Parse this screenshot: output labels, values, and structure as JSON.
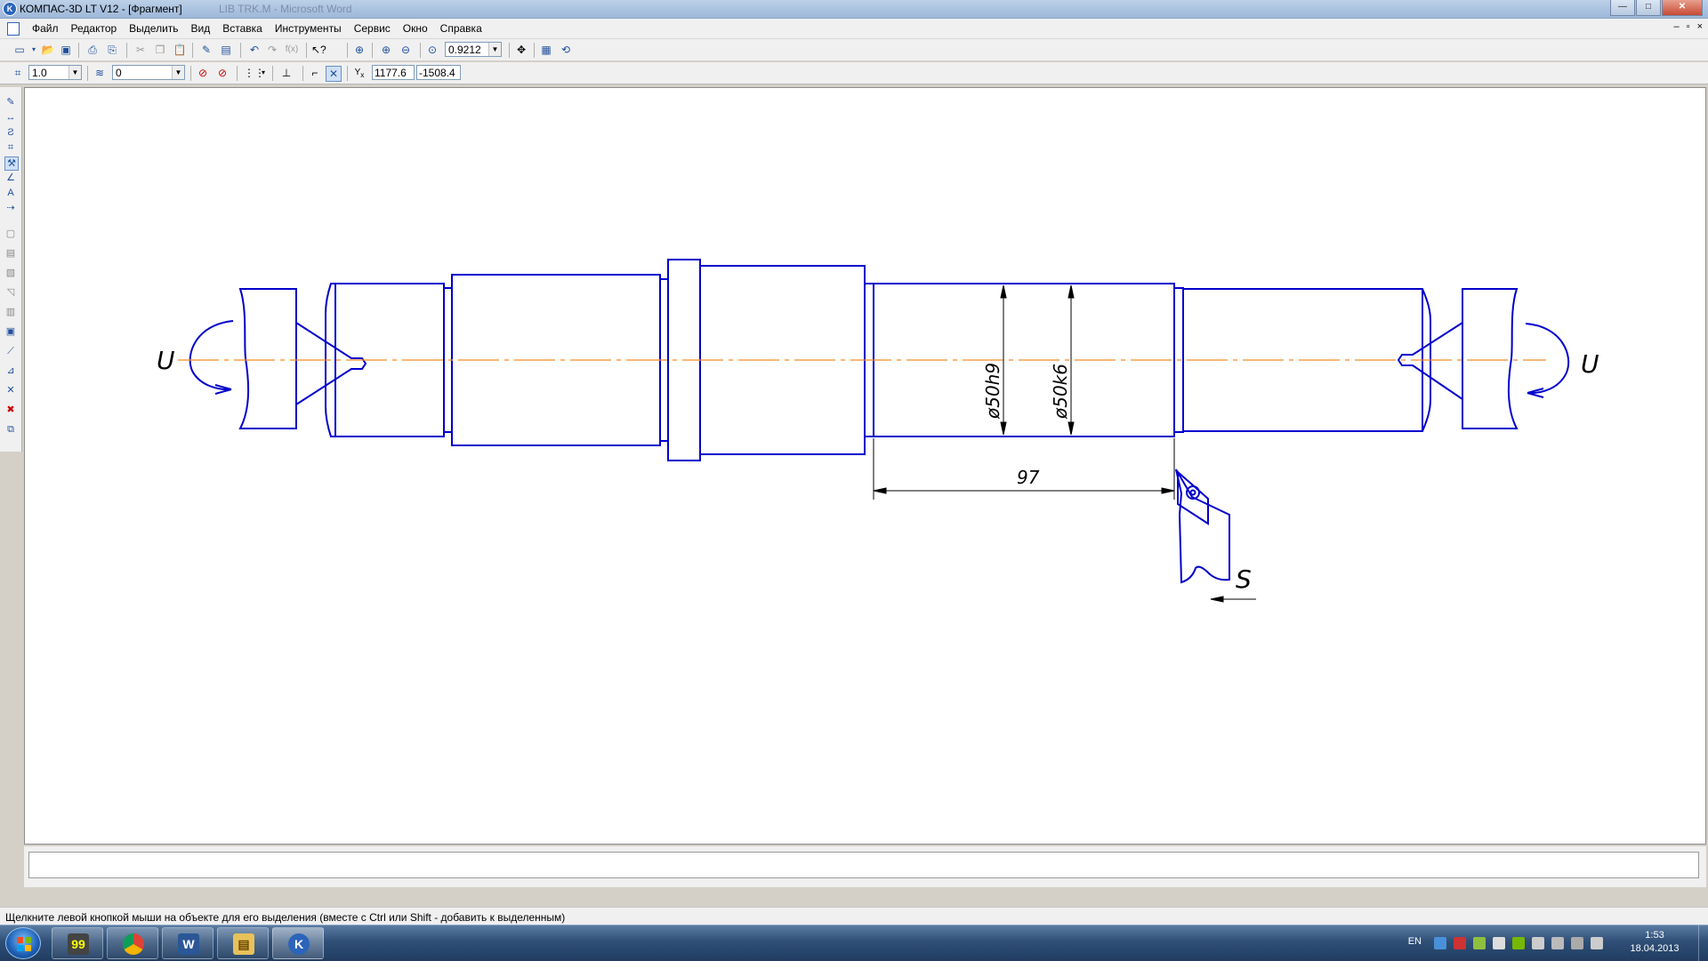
{
  "window": {
    "title": "КОМПАС-3D LT V12 - [Фрагмент]",
    "ghost_title": "LIB TRK.M - Microsoft Word",
    "controls": [
      "—",
      "□",
      "✕"
    ]
  },
  "menu": {
    "items": [
      "Файл",
      "Редактор",
      "Выделить",
      "Вид",
      "Вставка",
      "Инструменты",
      "Сервис",
      "Окно",
      "Справка"
    ],
    "mdi_controls": [
      "–",
      "▫",
      "×"
    ]
  },
  "toolbar1": {
    "zoom_value": "0.9212"
  },
  "toolbar2": {
    "step_value": "1.0",
    "layer_value": "0",
    "cursor_x": "1177.6",
    "cursor_y": "-1508.4"
  },
  "drawing": {
    "dimension_97": "97",
    "dim_h9": "ø50h9",
    "dim_k6": "ø50k6",
    "label_U_left": "U",
    "label_U_right": "U",
    "label_S": "S",
    "colors": {
      "geometry": "#0000cc",
      "axis": "#f28c28",
      "dimension": "#000000"
    }
  },
  "status": {
    "hint": "Щелкните левой кнопкой мыши на объекте для его выделения (вместе с Ctrl или Shift - добавить к выделенным)"
  },
  "taskbar": {
    "lang": "EN",
    "time": "1:53",
    "date": "18.04.2013",
    "apps": [
      "notes",
      "chrome",
      "word",
      "explorer",
      "kompas"
    ]
  }
}
